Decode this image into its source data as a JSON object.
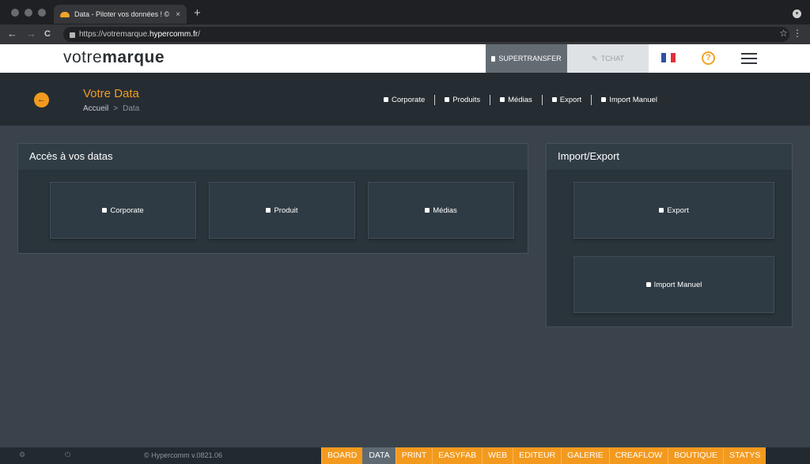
{
  "browser": {
    "tab_title": "Data - Piloter vos données ! ©",
    "tab_close": "×",
    "new_tab": "+",
    "url_prefix": "https://votremarque.",
    "url_domain": "hypercomm.fr",
    "url_suffix": "/",
    "back": "←",
    "forward": "→",
    "reload": "C",
    "star": "☆",
    "menu": "⋮"
  },
  "header": {
    "logo_light": "votre",
    "logo_bold": "marque",
    "supertransfer": "SUPERTRANSFER",
    "tchat": "TCHAT",
    "help": "?"
  },
  "page": {
    "title": "Votre Data",
    "breadcrumb": {
      "home": "Accueil",
      "sep": ">",
      "current": "Data"
    },
    "quicknav": [
      "Corporate",
      "Produits",
      "Médias",
      "Export",
      "Import Manuel"
    ]
  },
  "access_panel": {
    "title": "Accès à vos datas",
    "cards": [
      "Corporate",
      "Produit",
      "Médias"
    ]
  },
  "import_panel": {
    "title": "Import/Export",
    "cards": [
      "Export",
      "Import Manuel"
    ]
  },
  "footer": {
    "copyright": "© Hypercomm v.0821.06",
    "modules": [
      "BOARD",
      "DATA",
      "PRINT",
      "EASYFAB",
      "WEB",
      "EDITEUR",
      "GALERIE",
      "CREAFLOW",
      "BOUTIQUE",
      "STATYS"
    ],
    "active_module": "DATA"
  },
  "colors": {
    "accent": "#f39a1e",
    "background": "#3a434b",
    "panel": "#2a343b",
    "header_dark": "#252d33"
  },
  "icons": [
    "back-arrow-icon",
    "user-icon",
    "chart-icon",
    "image-icon",
    "box-icon",
    "help-icon",
    "menu-icon",
    "france-flag-icon",
    "gear-icon",
    "power-icon"
  ]
}
